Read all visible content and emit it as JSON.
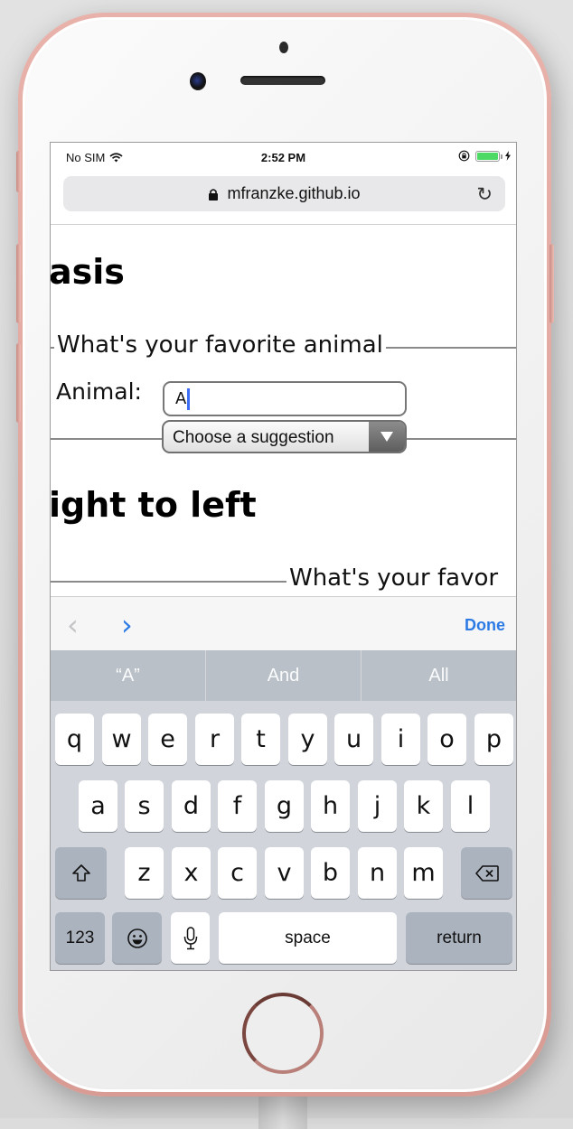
{
  "status_bar": {
    "carrier": "No SIM",
    "wifi_icon": "wifi-icon",
    "time": "2:52 PM",
    "orientation_lock_icon": "orientation-lock-icon",
    "battery_level": 1.0,
    "battery_color": "#4cd964",
    "charging_icon": "bolt-icon"
  },
  "browser": {
    "url": "mfranzke.github.io",
    "lock_icon": "lock-icon",
    "reload_glyph": "↻"
  },
  "page": {
    "section1_heading": "asis",
    "section1_legend": "What's your favorite animal",
    "animal_label": "Animal:",
    "animal_input_value": "A",
    "suggestion_select_value": "Choose a suggestion",
    "section2_heading": "ight to left",
    "section2_legend": "What's your favor"
  },
  "accessory_bar": {
    "prev_glyph": "‹",
    "next_glyph": "›",
    "done_label": "Done",
    "accent_color": "#2c7be5"
  },
  "predictions": [
    "“A”",
    "And",
    "All"
  ],
  "keyboard": {
    "row1": [
      "q",
      "w",
      "e",
      "r",
      "t",
      "y",
      "u",
      "i",
      "o",
      "p"
    ],
    "row2": [
      "a",
      "s",
      "d",
      "f",
      "g",
      "h",
      "j",
      "k",
      "l"
    ],
    "row3": [
      "z",
      "x",
      "c",
      "v",
      "b",
      "n",
      "m"
    ],
    "shift_glyph": "⇧",
    "delete_glyph": "⌫",
    "numbers_label": "123",
    "emoji_glyph": "☺",
    "mic_icon": "microphone-icon",
    "space_label": "space",
    "return_label": "return"
  }
}
